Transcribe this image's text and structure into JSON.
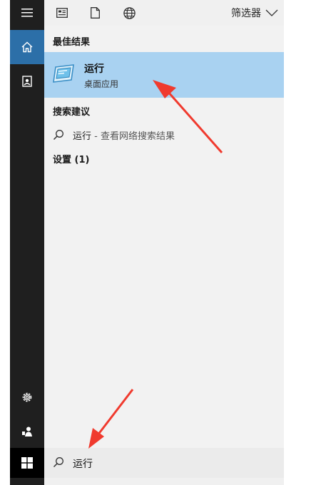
{
  "top_bar": {
    "icons": [
      "apps-filter-icon",
      "documents-filter-icon",
      "web-filter-icon"
    ],
    "filter_label": "筛选器"
  },
  "rail": {
    "icons": [
      "hamburger-icon",
      "home-icon",
      "documents-icon",
      "settings-icon",
      "user-icon",
      "windows-start-icon"
    ],
    "accent": "#2c6fa8"
  },
  "results": {
    "best_match_header": "最佳结果",
    "best_match": {
      "name": "运行",
      "subtitle": "桌面应用",
      "highlight": "#a9d2f1"
    },
    "suggestions_header": "搜索建议",
    "suggestion": {
      "query": "运行",
      "hint": " - 查看网络搜索结果"
    },
    "settings_header": "设置 (1)"
  },
  "search": {
    "query": "运行"
  },
  "annotations": {
    "arrow_color": "#f03a2e",
    "count": 2
  }
}
